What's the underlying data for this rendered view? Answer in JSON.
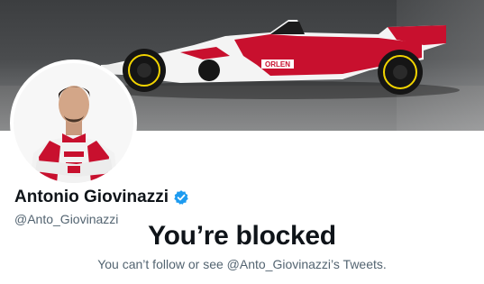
{
  "profile": {
    "display_name": "Antonio Giovinazzi",
    "handle": "@Anto_Giovinazzi",
    "verified": true,
    "verified_icon": "verified-badge-icon"
  },
  "banner": {
    "subject": "Formula 1 race car",
    "sponsor_text": "ORLEN"
  },
  "blocked": {
    "title": "You’re blocked",
    "message": "You can’t follow or see @Anto_Giovinazzi’s Tweets."
  },
  "colors": {
    "verified_blue": "#1d9bf0",
    "text_primary": "#0f1419",
    "text_secondary": "#536471",
    "livery_red": "#c8102e"
  }
}
